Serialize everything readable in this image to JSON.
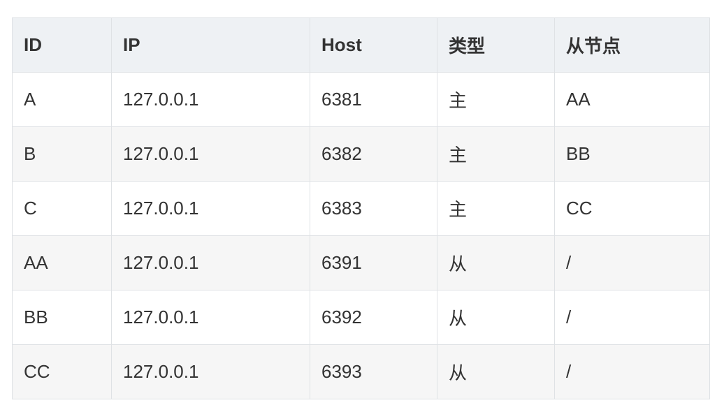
{
  "table": {
    "headers": [
      "ID",
      "IP",
      "Host",
      "类型",
      "从节点"
    ],
    "rows": [
      [
        "A",
        "127.0.0.1",
        "6381",
        "主",
        "AA"
      ],
      [
        "B",
        "127.0.0.1",
        "6382",
        "主",
        "BB"
      ],
      [
        "C",
        "127.0.0.1",
        "6383",
        "主",
        "CC"
      ],
      [
        "AA",
        "127.0.0.1",
        "6391",
        "从",
        "/"
      ],
      [
        "BB",
        "127.0.0.1",
        "6392",
        "从",
        "/"
      ],
      [
        "CC",
        "127.0.0.1",
        "6393",
        "从",
        "/"
      ]
    ]
  },
  "colors": {
    "header_bg": "#eef1f4",
    "border": "#dfe2e5",
    "row_alt_bg": "#f6f6f6",
    "text": "#333333"
  }
}
